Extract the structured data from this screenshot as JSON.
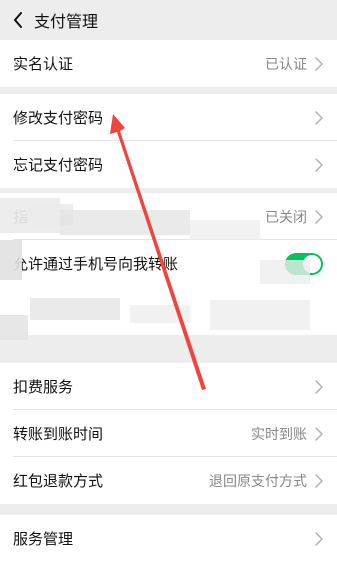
{
  "header": {
    "title": "支付管理"
  },
  "sections": {
    "verification": {
      "label": "实名认证",
      "value": "已认证"
    },
    "password": {
      "change_label": "修改支付密码",
      "forgot_label": "忘记支付密码"
    },
    "security": {
      "fingerprint_label": "指纹",
      "fingerprint_value": "已关闭",
      "phone_transfer_label": "允许通过手机号向我转账",
      "phone_transfer_enabled": true
    },
    "services": {
      "deduction_label": "扣费服务",
      "transfer_time_label": "转账到账时间",
      "transfer_time_value": "实时到账",
      "refund_label": "红包退款方式",
      "refund_value": "退回原支付方式",
      "service_mgmt_label": "服务管理"
    }
  },
  "colors": {
    "background": "#ededed",
    "card": "#ffffff",
    "toggle_on": "#07c160",
    "annotation_arrow": "#f0443e"
  },
  "icons": {
    "back": "chevron-left-icon",
    "row_chevron": "chevron-right-icon"
  }
}
